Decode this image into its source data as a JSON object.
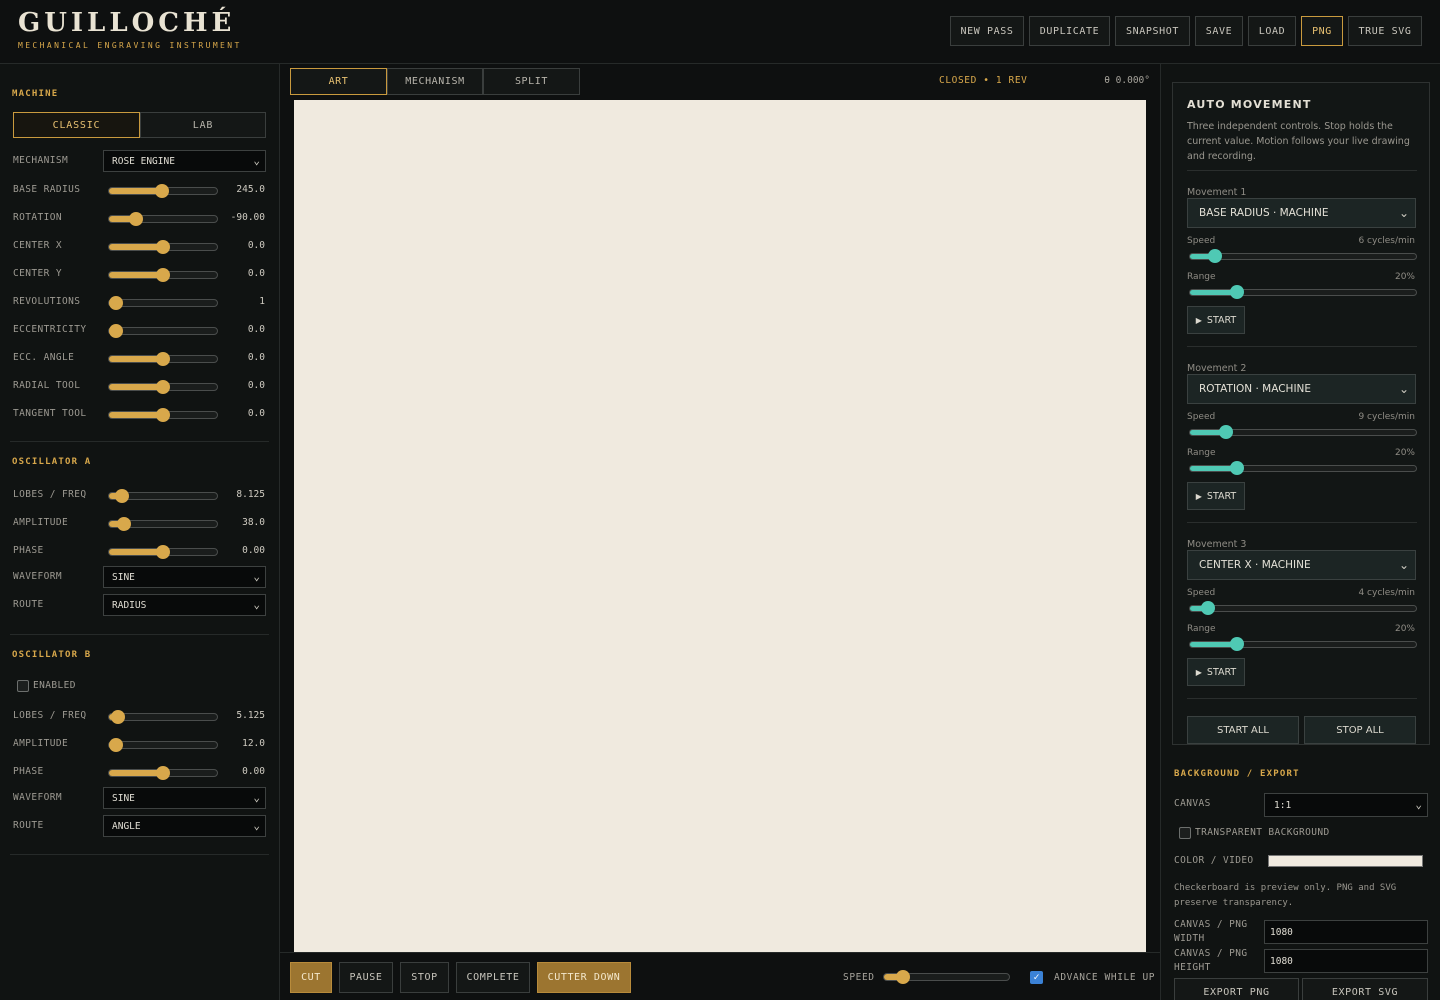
{
  "header": {
    "title": "GUILLOCHÉ",
    "subtitle": "MECHANICAL ENGRAVING INSTRUMENT",
    "buttons": [
      "NEW PASS",
      "DUPLICATE",
      "SNAPSHOT",
      "SAVE",
      "LOAD",
      "PNG",
      "TRUE SVG"
    ],
    "active_button": "PNG"
  },
  "machine": {
    "title": "MACHINE",
    "modes": [
      "CLASSIC",
      "LAB"
    ],
    "active_mode": "CLASSIC",
    "mechanism_label": "MECHANISM",
    "mechanism_value": "ROSE ENGINE",
    "params": [
      {
        "label": "BASE RADIUS",
        "value": "245.0",
        "level": 0.49
      },
      {
        "label": "ROTATION",
        "value": "-90.00",
        "level": 0.25
      },
      {
        "label": "CENTER X",
        "value": "0.0",
        "level": 0.5
      },
      {
        "label": "CENTER Y",
        "value": "0.0",
        "level": 0.5
      },
      {
        "label": "REVOLUTIONS",
        "value": "1",
        "level": 0.0
      },
      {
        "label": "ECCENTRICITY",
        "value": "0.0",
        "level": 0.0
      },
      {
        "label": "ECC. ANGLE",
        "value": "0.0",
        "level": 0.5
      },
      {
        "label": "RADIAL TOOL",
        "value": "0.0",
        "level": 0.5
      },
      {
        "label": "TANGENT TOOL",
        "value": "0.0",
        "level": 0.5
      }
    ]
  },
  "osc_a": {
    "title": "OSCILLATOR A",
    "params": [
      {
        "label": "LOBES / FREQ",
        "value": "8.125",
        "level": 0.12
      },
      {
        "label": "AMPLITUDE",
        "value": "38.0",
        "level": 0.14
      },
      {
        "label": "PHASE",
        "value": "0.00",
        "level": 0.5
      }
    ],
    "waveform_label": "WAVEFORM",
    "waveform_value": "SINE",
    "route_label": "ROUTE",
    "route_value": "RADIUS"
  },
  "osc_b": {
    "title": "OSCILLATOR B",
    "enabled_label": "ENABLED",
    "params": [
      {
        "label": "LOBES / FREQ",
        "value": "5.125",
        "level": 0.08
      },
      {
        "label": "AMPLITUDE",
        "value": "12.0",
        "level": 0.05
      },
      {
        "label": "PHASE",
        "value": "0.00",
        "level": 0.5
      }
    ],
    "waveform_label": "WAVEFORM",
    "waveform_value": "SINE",
    "route_label": "ROUTE",
    "route_value": "ANGLE"
  },
  "view": {
    "tabs": [
      "ART",
      "MECHANISM",
      "SPLIT"
    ],
    "active_tab": "ART",
    "status": "CLOSED • 1 REV",
    "angle": "θ 0.000°",
    "canvas_color": "#f0eadf"
  },
  "controls": {
    "cut": "CUT",
    "pause": "PAUSE",
    "stop": "STOP",
    "complete": "COMPLETE",
    "cutter_down": "CUTTER DOWN",
    "speed_label": "SPEED",
    "speed_level": 0.15,
    "advance_label": "ADVANCE WHILE UP"
  },
  "auto": {
    "title": "AUTO MOVEMENT",
    "description": "Three independent controls. Stop holds the current value. Motion follows your live drawing and recording.",
    "movements": [
      {
        "label": "Movement 1",
        "target": "BASE RADIUS · MACHINE",
        "speed_label": "Speed",
        "speed_value": "6 cycles/min",
        "speed_level": 0.11,
        "range_label": "Range",
        "range_value": "20%",
        "range_level": 0.21,
        "start": "START"
      },
      {
        "label": "Movement 2",
        "target": "ROTATION · MACHINE",
        "speed_label": "Speed",
        "speed_value": "9 cycles/min",
        "speed_level": 0.16,
        "range_label": "Range",
        "range_value": "20%",
        "range_level": 0.21,
        "start": "START"
      },
      {
        "label": "Movement 3",
        "target": "CENTER X · MACHINE",
        "speed_label": "Speed",
        "speed_value": "4 cycles/min",
        "speed_level": 0.08,
        "range_label": "Range",
        "range_value": "20%",
        "range_level": 0.21,
        "start": "START"
      }
    ],
    "start_all": "START ALL",
    "stop_all": "STOP ALL"
  },
  "bg_export": {
    "title": "BACKGROUND / EXPORT",
    "canvas_label": "CANVAS",
    "canvas_value": "1:1",
    "transparent_label": "TRANSPARENT BACKGROUND",
    "color_label": "COLOR / VIDEO",
    "color_value": "#f0eadf",
    "note": "Checkerboard is preview only. PNG and SVG preserve transparency.",
    "width_label": "CANVAS / PNG WIDTH",
    "width_value": "1080",
    "height_label": "CANVAS / PNG HEIGHT",
    "height_value": "1080",
    "export_png": "EXPORT PNG",
    "export_svg": "EXPORT SVG"
  }
}
